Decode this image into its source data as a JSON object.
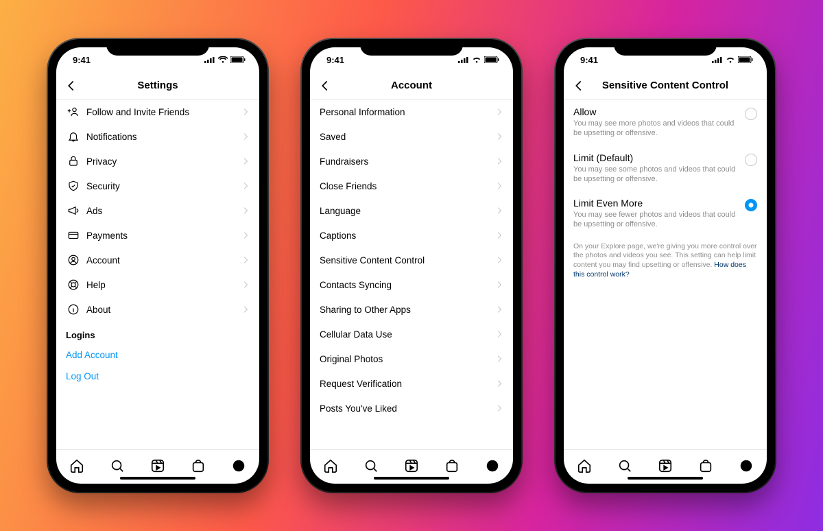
{
  "status": {
    "time": "9:41"
  },
  "colors": {
    "link_blue": "#0095f6",
    "accent_blue": "#0095f6",
    "grey_text": "#8e8e8e"
  },
  "phone1": {
    "title": "Settings",
    "items": [
      {
        "icon": "add-user-icon",
        "label": "Follow and Invite Friends"
      },
      {
        "icon": "bell-icon",
        "label": "Notifications"
      },
      {
        "icon": "lock-icon",
        "label": "Privacy"
      },
      {
        "icon": "shield-icon",
        "label": "Security"
      },
      {
        "icon": "megaphone-icon",
        "label": "Ads"
      },
      {
        "icon": "card-icon",
        "label": "Payments"
      },
      {
        "icon": "user-circle-icon",
        "label": "Account"
      },
      {
        "icon": "lifebuoy-icon",
        "label": "Help"
      },
      {
        "icon": "info-icon",
        "label": "About"
      }
    ],
    "logins_label": "Logins",
    "add_account": "Add Account",
    "log_out": "Log Out"
  },
  "phone2": {
    "title": "Account",
    "items": [
      {
        "label": "Personal Information"
      },
      {
        "label": "Saved"
      },
      {
        "label": "Fundraisers"
      },
      {
        "label": "Close Friends"
      },
      {
        "label": "Language"
      },
      {
        "label": "Captions"
      },
      {
        "label": "Sensitive Content Control"
      },
      {
        "label": "Contacts Syncing"
      },
      {
        "label": "Sharing to Other Apps"
      },
      {
        "label": "Cellular Data Use"
      },
      {
        "label": "Original Photos"
      },
      {
        "label": "Request Verification"
      },
      {
        "label": "Posts You've Liked"
      }
    ]
  },
  "phone3": {
    "title": "Sensitive Content Control",
    "options": [
      {
        "title": "Allow",
        "desc": "You may see more photos and videos that could be upsetting or offensive.",
        "selected": false
      },
      {
        "title": "Limit (Default)",
        "desc": "You may see some photos and videos that could be upsetting or offensive.",
        "selected": false
      },
      {
        "title": "Limit Even More",
        "desc": "You may see fewer photos and videos that could be upsetting or offensive.",
        "selected": true
      }
    ],
    "explainer_text": "On your Explore page, we're giving you more control over the photos and videos you see. This setting can help limit content you may find upsetting or offensive. ",
    "explainer_link": "How does this control work?"
  },
  "tabbar": {
    "tabs": [
      "home-icon",
      "search-icon",
      "reels-icon",
      "shop-icon",
      "profile-icon"
    ]
  }
}
